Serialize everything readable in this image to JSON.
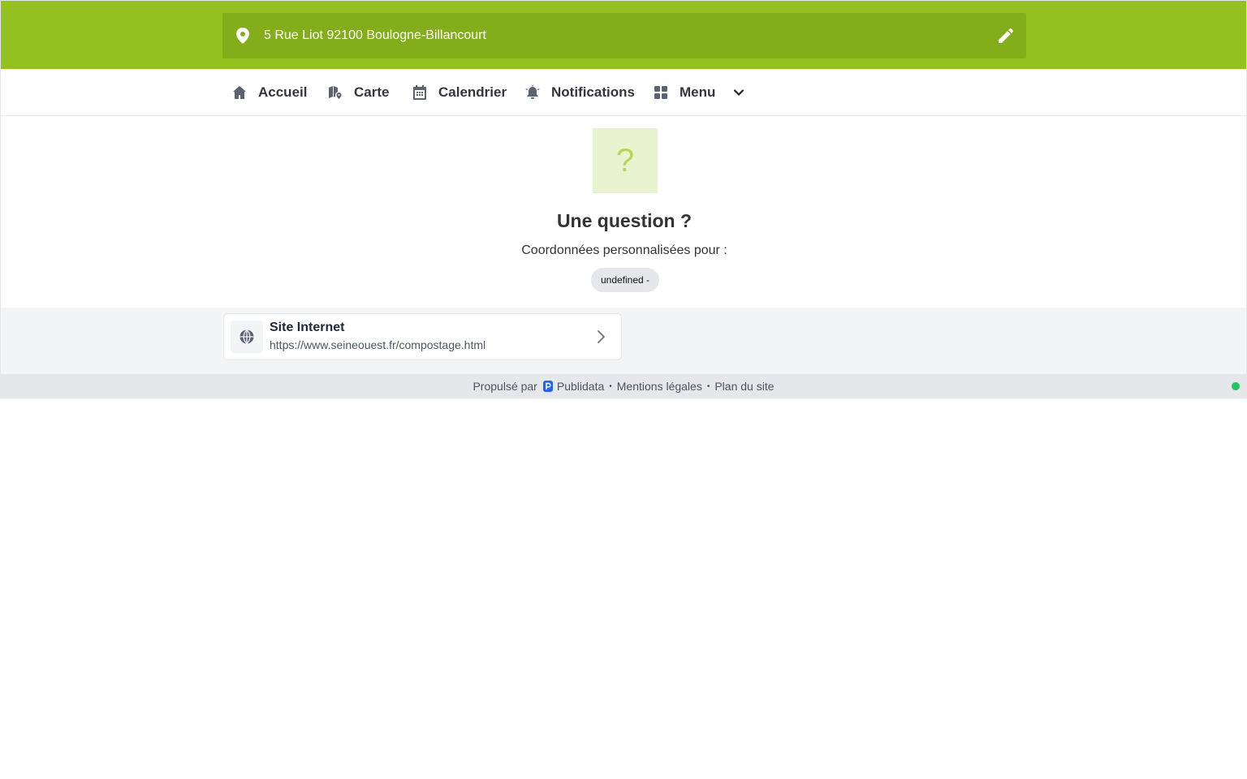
{
  "header": {
    "address": "5 Rue Liot 92100 Boulogne-Billancourt",
    "accent_color": "#94c11f",
    "pin_icon": "map-pin-icon",
    "edit_icon": "pencil-icon"
  },
  "nav": {
    "items": [
      {
        "label": "Accueil",
        "icon": "home-icon"
      },
      {
        "label": "Carte",
        "icon": "map-marker-icon"
      },
      {
        "label": "Calendrier",
        "icon": "calendar-icon"
      },
      {
        "label": "Notifications",
        "icon": "bell-alert-icon"
      },
      {
        "label": "Menu",
        "icon": "grid-icon"
      }
    ]
  },
  "main": {
    "icon_glyph": "?",
    "title": "Une question ?",
    "subtitle": "Coordonnées personnalisées pour :",
    "badge": "undefined -"
  },
  "links": [
    {
      "title": "Site Internet",
      "url": "https://www.seineouest.fr/compostage.html",
      "icon": "globe-icon"
    }
  ],
  "footer": {
    "powered_by": "Propulsé par",
    "brand": "Publidata",
    "legal": "Mentions légales",
    "sitemap": "Plan du site",
    "separator": "•",
    "status_color": "#22c55e"
  }
}
